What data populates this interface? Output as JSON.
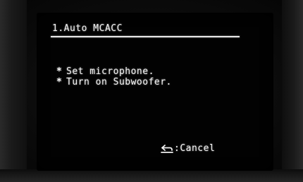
{
  "screen": {
    "title": "1.Auto MCACC",
    "instructions": [
      {
        "bullet": "*",
        "text": "Set microphone."
      },
      {
        "bullet": "*",
        "text": "Turn on Subwoofer."
      }
    ],
    "cancel_label": ":Cancel",
    "cancel_icon": "return-icon"
  },
  "colors": {
    "text": "#f2f2f2",
    "screen_background": "#020202"
  }
}
